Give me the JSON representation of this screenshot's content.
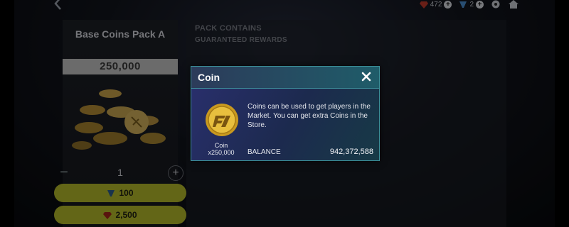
{
  "topbar": {
    "currency1": {
      "icon": "gem-icon",
      "value": "472"
    },
    "currency2": {
      "icon": "points-icon",
      "value": "2"
    }
  },
  "pack": {
    "title": "Base Coins Pack A",
    "amount": "250,000",
    "quantity": "1",
    "minus": "−",
    "plus": "+",
    "price_points": "100",
    "price_gems": "2,500"
  },
  "contains": {
    "title": "PACK CONTAINS",
    "subtitle": "GUARANTEED REWARDS"
  },
  "modal": {
    "title": "Coin",
    "coin_name": "Coin",
    "coin_qty": "x250,000",
    "description": "Coins can be used to get players in the Market. You can get extra Coins in the Store.",
    "balance_label": "BALANCE",
    "balance_value": "942,372,588"
  },
  "colors": {
    "buy_button": "#b5ba2b",
    "modal_border": "#3b8f98"
  }
}
